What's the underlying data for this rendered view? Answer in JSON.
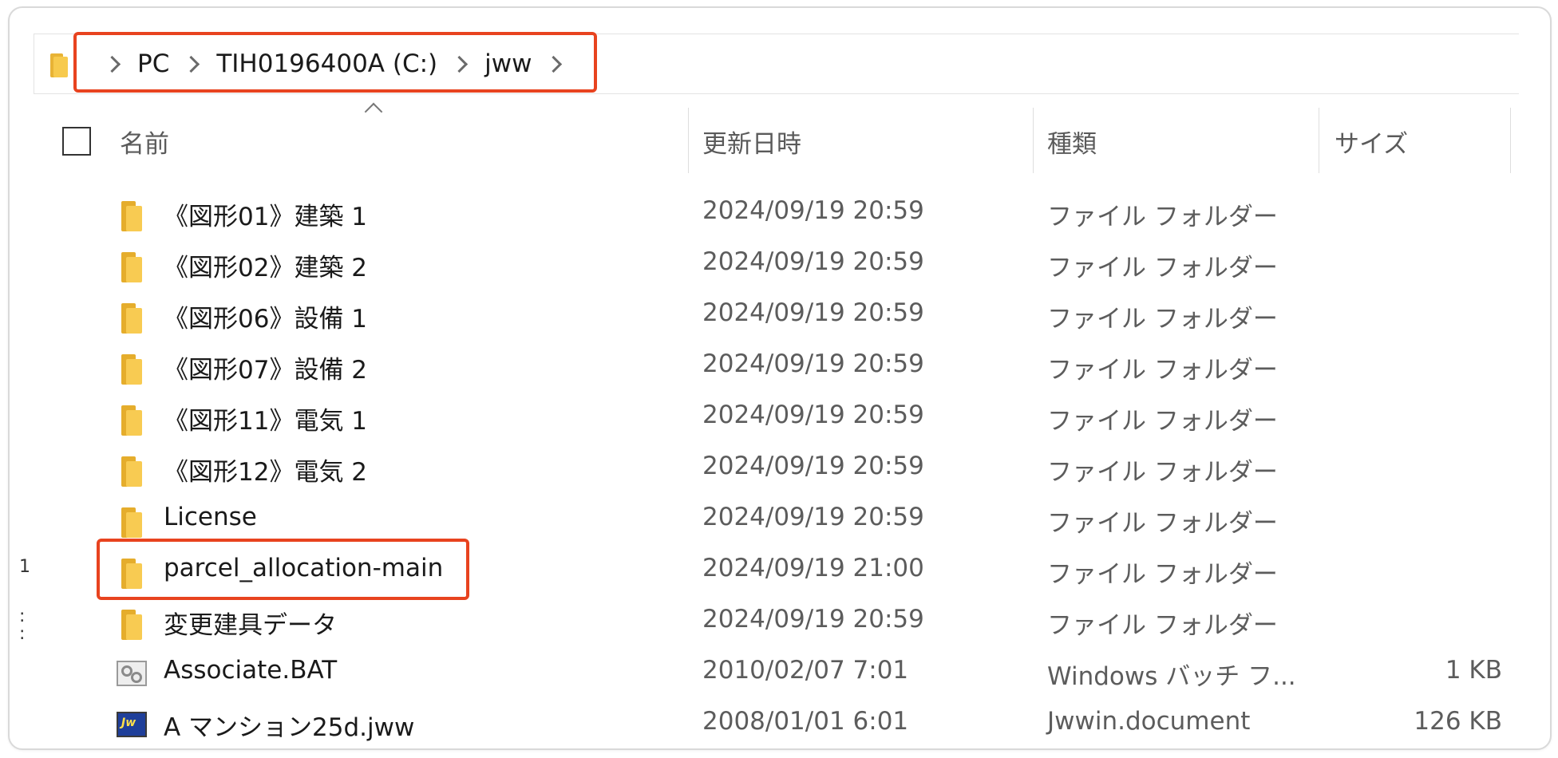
{
  "address_bar": {
    "crumbs": [
      "PC",
      "TIH0196400A (C:)",
      "jww"
    ]
  },
  "columns": {
    "name": "名前",
    "modified": "更新日時",
    "type": "種類",
    "size": "サイズ"
  },
  "files": [
    {
      "name": "《図形01》建築 1",
      "modified": "2024/09/19 20:59",
      "type": "ファイル フォルダー",
      "size": "",
      "icon": "folder-icon"
    },
    {
      "name": "《図形02》建築 2",
      "modified": "2024/09/19 20:59",
      "type": "ファイル フォルダー",
      "size": "",
      "icon": "folder-icon"
    },
    {
      "name": "《図形06》設備 1",
      "modified": "2024/09/19 20:59",
      "type": "ファイル フォルダー",
      "size": "",
      "icon": "folder-icon"
    },
    {
      "name": "《図形07》設備 2",
      "modified": "2024/09/19 20:59",
      "type": "ファイル フォルダー",
      "size": "",
      "icon": "folder-icon"
    },
    {
      "name": "《図形11》電気 1",
      "modified": "2024/09/19 20:59",
      "type": "ファイル フォルダー",
      "size": "",
      "icon": "folder-icon"
    },
    {
      "name": "《図形12》電気 2",
      "modified": "2024/09/19 20:59",
      "type": "ファイル フォルダー",
      "size": "",
      "icon": "folder-icon"
    },
    {
      "name": "License",
      "modified": "2024/09/19 20:59",
      "type": "ファイル フォルダー",
      "size": "",
      "icon": "folder-icon"
    },
    {
      "name": "parcel_allocation-main",
      "modified": "2024/09/19 21:00",
      "type": "ファイル フォルダー",
      "size": "",
      "icon": "folder-icon"
    },
    {
      "name": "変更建具データ",
      "modified": "2024/09/19 20:59",
      "type": "ファイル フォルダー",
      "size": "",
      "icon": "folder-icon"
    },
    {
      "name": "Associate.BAT",
      "modified": "2010/02/07 7:01",
      "type": "Windows バッチ フ...",
      "size": "1 KB",
      "icon": "batch-file-icon"
    },
    {
      "name": "A マンション25d.jww",
      "modified": "2008/01/01 6:01",
      "type": "Jwwin.document",
      "size": "126 KB",
      "icon": "jww-file-icon"
    }
  ],
  "highlight_color": "#e8431f",
  "left_edge_marks": [
    "1",
    ":",
    ":"
  ]
}
